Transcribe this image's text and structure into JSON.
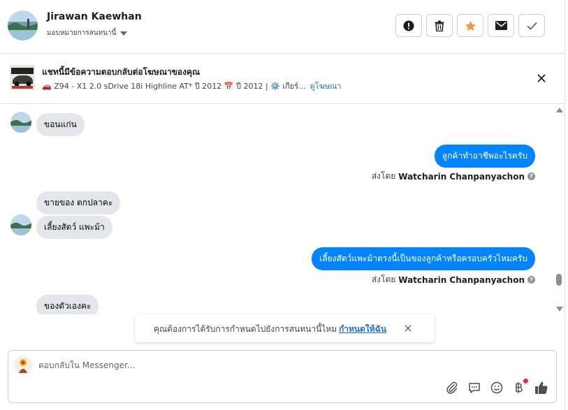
{
  "header": {
    "contact_name": "Jirawan Kaewhan",
    "assign_label": "มอบหมายการสนทนานี้",
    "actions": [
      "mark-spam",
      "delete",
      "star",
      "mark-unread",
      "mark-done"
    ]
  },
  "ad": {
    "title": "แชทนี้มีข้อความตอบกลับต่อโฆษณาของคุณ",
    "details": "🚗 Z94 - X1 2.0 sDrive 18i Highline AT* ปี 2012 📅 ปี 2012 | ⚙️ เกียร์...",
    "link": "ดูโฆษณา"
  },
  "messages": [
    {
      "side": "in",
      "text": "ขอนแก่น"
    },
    {
      "side": "out",
      "text": "ลูกค้าทำอาชีพอะไรครับ",
      "sent_by_prefix": "ส่งโดย",
      "sent_by": "Watcharin Chanpanyachon"
    },
    {
      "side": "in",
      "text": "ขายของ  ตกปลาคะ"
    },
    {
      "side": "in",
      "text": "เลี้ยงสัตว์  แพะม้า"
    },
    {
      "side": "out",
      "text": "เลี้ยงสัตว์แพะม้าตรงนี้เป็นของลูกค้าหรือครอบครัวไหมครับ",
      "sent_by_prefix": "ส่งโดย",
      "sent_by": "Watcharin Chanpanyachon"
    },
    {
      "side": "in",
      "text": "ของตัวเองคะ"
    }
  ],
  "toast": {
    "text": "คุณต้องการได้รับการกำหนดไปยังการสนทนานี้ไหม",
    "link": "กำหนดให้ฉัน"
  },
  "composer": {
    "placeholder": "ตอบกลับใน Messenger..."
  },
  "colors": {
    "outgoing_bubble": "#0084ff",
    "incoming_bubble": "#e4e6eb",
    "link": "#216fdb",
    "star": "#f7923b"
  }
}
